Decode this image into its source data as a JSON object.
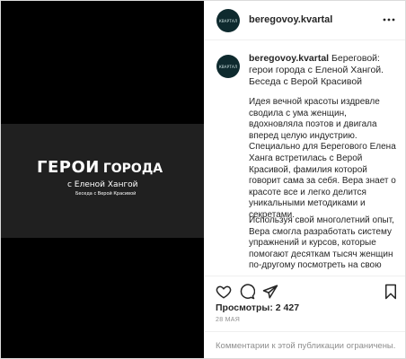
{
  "media": {
    "title_big": "ГЕРОИ",
    "title_small": "ГОРОДА",
    "subtitle": "с Еленой Хангой",
    "subtitle2": "Беседа с Верой Красивой"
  },
  "header": {
    "avatar_text": "КВАРТАЛ",
    "username": "beregovoy.kvartal"
  },
  "caption": {
    "username": "beregovoy.kvartal",
    "head_text": " Береговой: герои города с Еленой Хангой. Беседа с Верой Красивой",
    "paragraph1": "Идея вечной красоты издревле сводила с ума женщин, вдохновляла поэтов и двигала вперед целую индустрию. Специально для Берегового Елена Ханга встретилась с Верой Красивой, фамилия которой говорит сама за себя. Вера знает о красоте все и легко делится уникальными методиками и секретами.",
    "paragraph2": "Используя свой многолетний опыт, Вера смогла разработать систему упражнений и курсов, которые помогают десяткам тысяч женщин по-другому посмотреть на свою"
  },
  "icons": {
    "more": "more-horizontal-icon",
    "like": "heart-icon",
    "comment": "comment-bubble-icon",
    "share": "paper-plane-icon",
    "save": "bookmark-icon"
  },
  "stats": {
    "views": "Просмотры: 2 427",
    "date": "28 МАЯ"
  },
  "footer": {
    "comments_disabled": "Комментарии к этой публикации ограничены."
  },
  "colors": {
    "media_bg": "#000000",
    "banner_bg": "#202020",
    "muted_text": "#8e8e8e",
    "avatar_bg": "#0e2a2e"
  }
}
